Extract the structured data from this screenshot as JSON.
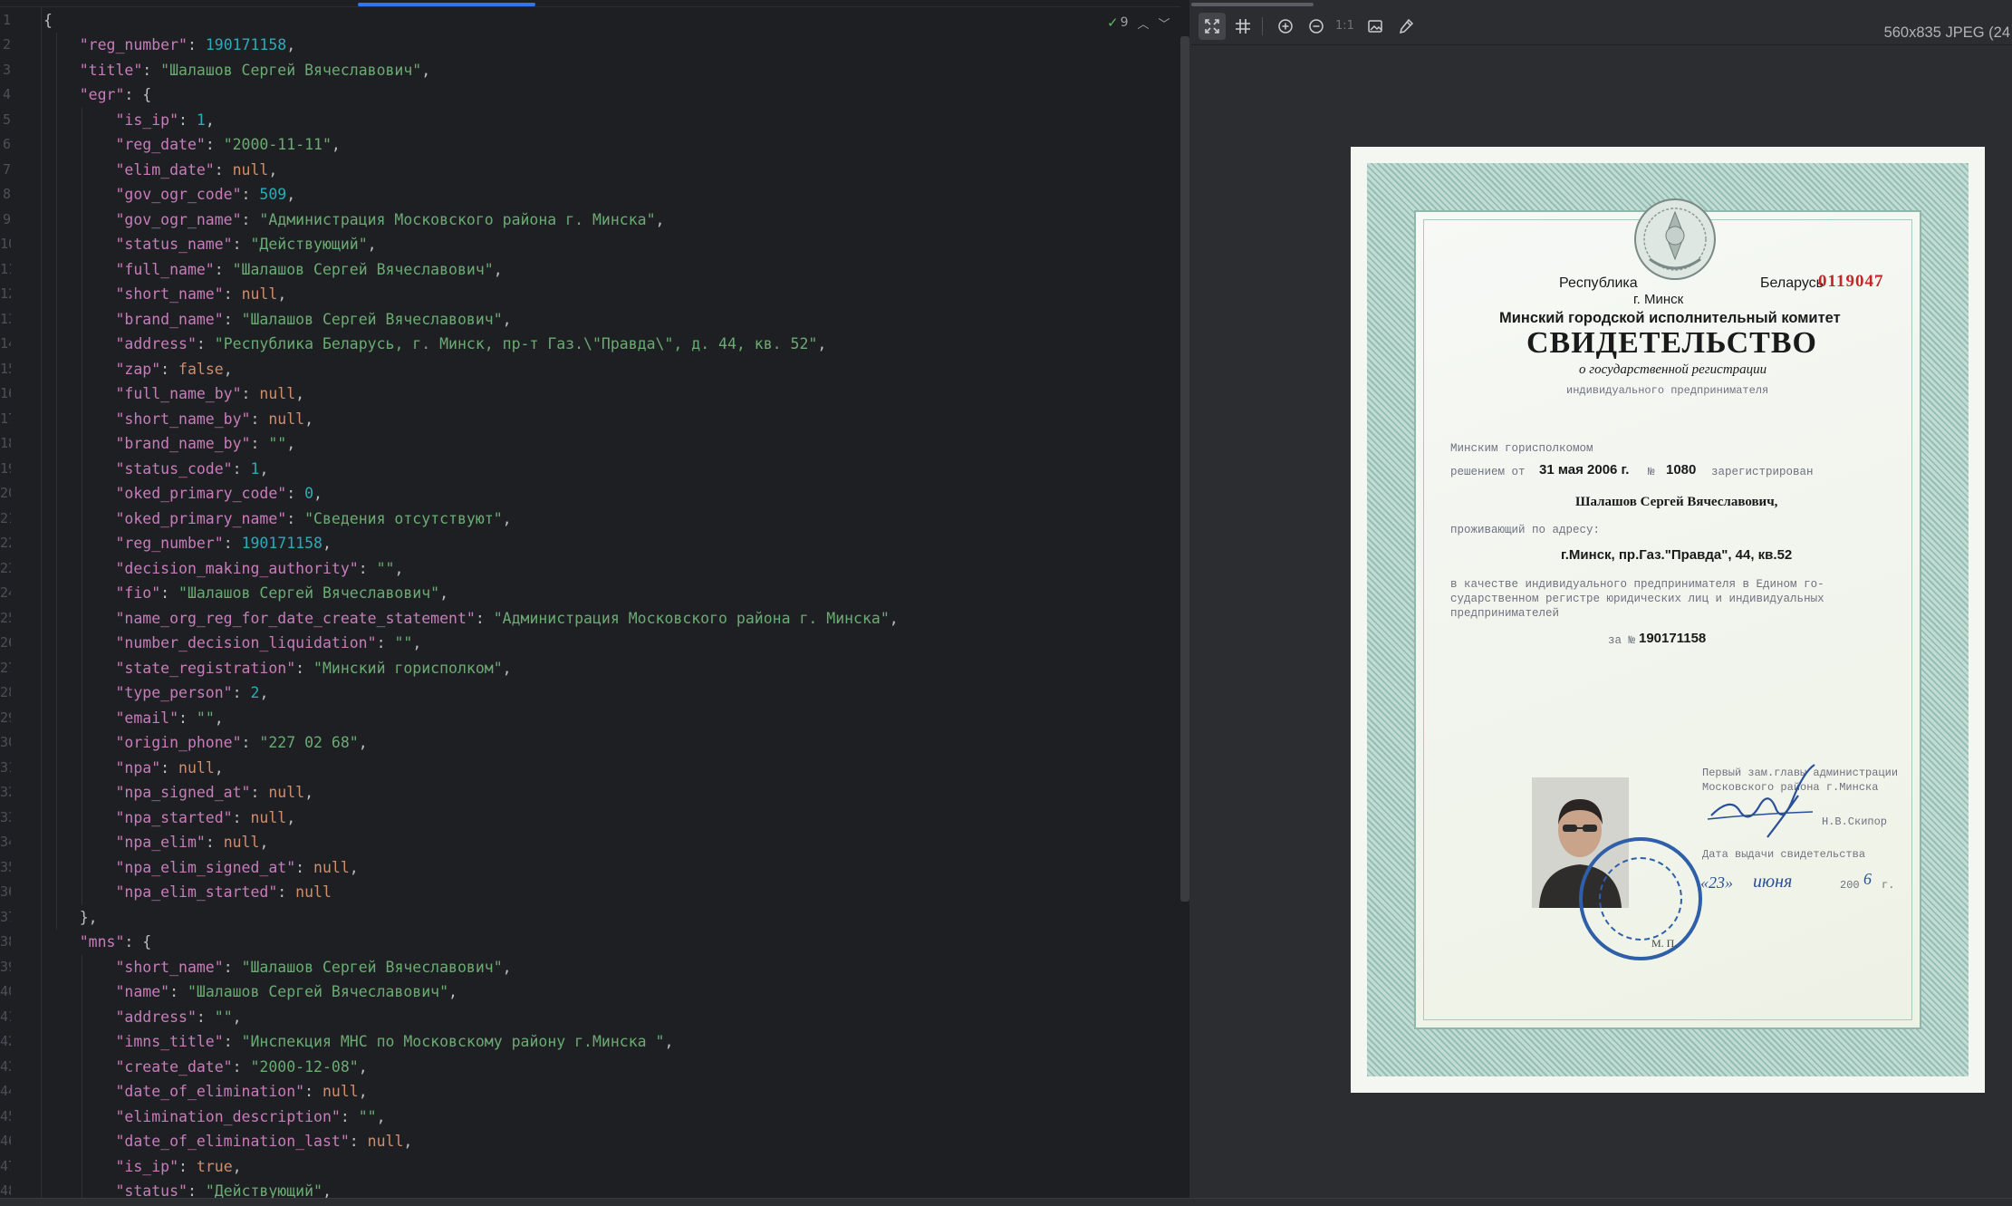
{
  "editor": {
    "lines": [
      [
        [
          "p",
          "{"
        ]
      ],
      [
        [
          "k",
          "    \"reg_number\""
        ],
        [
          "p",
          ": "
        ],
        [
          "n",
          "190171158"
        ],
        [
          "p",
          ","
        ]
      ],
      [
        [
          "k",
          "    \"title\""
        ],
        [
          "p",
          ": "
        ],
        [
          "s",
          "\"Шалашов Сергей Вячеславович\""
        ],
        [
          "p",
          ","
        ]
      ],
      [
        [
          "k",
          "    \"egr\""
        ],
        [
          "p",
          ": {"
        ]
      ],
      [
        [
          "k",
          "        \"is_ip\""
        ],
        [
          "p",
          ": "
        ],
        [
          "n",
          "1"
        ],
        [
          "p",
          ","
        ]
      ],
      [
        [
          "k",
          "        \"reg_date\""
        ],
        [
          "p",
          ": "
        ],
        [
          "s",
          "\"2000-11-11\""
        ],
        [
          "p",
          ","
        ]
      ],
      [
        [
          "k",
          "        \"elim_date\""
        ],
        [
          "p",
          ": "
        ],
        [
          "kw",
          "null"
        ],
        [
          "p",
          ","
        ]
      ],
      [
        [
          "k",
          "        \"gov_ogr_code\""
        ],
        [
          "p",
          ": "
        ],
        [
          "n",
          "509"
        ],
        [
          "p",
          ","
        ]
      ],
      [
        [
          "k",
          "        \"gov_ogr_name\""
        ],
        [
          "p",
          ": "
        ],
        [
          "s",
          "\"Администрация Московского района г. Минска\""
        ],
        [
          "p",
          ","
        ]
      ],
      [
        [
          "k",
          "        \"status_name\""
        ],
        [
          "p",
          ": "
        ],
        [
          "s",
          "\"Действующий\""
        ],
        [
          "p",
          ","
        ]
      ],
      [
        [
          "k",
          "        \"full_name\""
        ],
        [
          "p",
          ": "
        ],
        [
          "s",
          "\"Шалашов Сергей Вячеславович\""
        ],
        [
          "p",
          ","
        ]
      ],
      [
        [
          "k",
          "        \"short_name\""
        ],
        [
          "p",
          ": "
        ],
        [
          "kw",
          "null"
        ],
        [
          "p",
          ","
        ]
      ],
      [
        [
          "k",
          "        \"brand_name\""
        ],
        [
          "p",
          ": "
        ],
        [
          "s",
          "\"Шалашов Сергей Вячеславович\""
        ],
        [
          "p",
          ","
        ]
      ],
      [
        [
          "k",
          "        \"address\""
        ],
        [
          "p",
          ": "
        ],
        [
          "s",
          "\"Республика Беларусь, г. Минск, пр-т Газ.\\\"Правда\\\", д. 44, кв. 52\""
        ],
        [
          "p",
          ","
        ]
      ],
      [
        [
          "k",
          "        \"zap\""
        ],
        [
          "p",
          ": "
        ],
        [
          "kw",
          "false"
        ],
        [
          "p",
          ","
        ]
      ],
      [
        [
          "k",
          "        \"full_name_by\""
        ],
        [
          "p",
          ": "
        ],
        [
          "kw",
          "null"
        ],
        [
          "p",
          ","
        ]
      ],
      [
        [
          "k",
          "        \"short_name_by\""
        ],
        [
          "p",
          ": "
        ],
        [
          "kw",
          "null"
        ],
        [
          "p",
          ","
        ]
      ],
      [
        [
          "k",
          "        \"brand_name_by\""
        ],
        [
          "p",
          ": "
        ],
        [
          "s",
          "\"\""
        ],
        [
          "p",
          ","
        ]
      ],
      [
        [
          "k",
          "        \"status_code\""
        ],
        [
          "p",
          ": "
        ],
        [
          "n",
          "1"
        ],
        [
          "p",
          ","
        ]
      ],
      [
        [
          "k",
          "        \"oked_primary_code\""
        ],
        [
          "p",
          ": "
        ],
        [
          "n",
          "0"
        ],
        [
          "p",
          ","
        ]
      ],
      [
        [
          "k",
          "        \"oked_primary_name\""
        ],
        [
          "p",
          ": "
        ],
        [
          "s",
          "\"Сведения отсутствуют\""
        ],
        [
          "p",
          ","
        ]
      ],
      [
        [
          "k",
          "        \"reg_number\""
        ],
        [
          "p",
          ": "
        ],
        [
          "n",
          "190171158"
        ],
        [
          "p",
          ","
        ]
      ],
      [
        [
          "k",
          "        \"decision_making_authority\""
        ],
        [
          "p",
          ": "
        ],
        [
          "s",
          "\"\""
        ],
        [
          "p",
          ","
        ]
      ],
      [
        [
          "k",
          "        \"fio\""
        ],
        [
          "p",
          ": "
        ],
        [
          "s",
          "\"Шалашов Сергей Вячеславович\""
        ],
        [
          "p",
          ","
        ]
      ],
      [
        [
          "k",
          "        \"name_org_reg_for_date_create_statement\""
        ],
        [
          "p",
          ": "
        ],
        [
          "s",
          "\"Администрация Московского района г. Минска\""
        ],
        [
          "p",
          ","
        ]
      ],
      [
        [
          "k",
          "        \"number_decision_liquidation\""
        ],
        [
          "p",
          ": "
        ],
        [
          "s",
          "\"\""
        ],
        [
          "p",
          ","
        ]
      ],
      [
        [
          "k",
          "        \"state_registration\""
        ],
        [
          "p",
          ": "
        ],
        [
          "s",
          "\"Минский горисполком\""
        ],
        [
          "p",
          ","
        ]
      ],
      [
        [
          "k",
          "        \"type_person\""
        ],
        [
          "p",
          ": "
        ],
        [
          "n",
          "2"
        ],
        [
          "p",
          ","
        ]
      ],
      [
        [
          "k",
          "        \"email\""
        ],
        [
          "p",
          ": "
        ],
        [
          "s",
          "\"\""
        ],
        [
          "p",
          ","
        ]
      ],
      [
        [
          "k",
          "        \"origin_phone\""
        ],
        [
          "p",
          ": "
        ],
        [
          "s",
          "\"227 02 68\""
        ],
        [
          "p",
          ","
        ]
      ],
      [
        [
          "k",
          "        \"npa\""
        ],
        [
          "p",
          ": "
        ],
        [
          "kw",
          "null"
        ],
        [
          "p",
          ","
        ]
      ],
      [
        [
          "k",
          "        \"npa_signed_at\""
        ],
        [
          "p",
          ": "
        ],
        [
          "kw",
          "null"
        ],
        [
          "p",
          ","
        ]
      ],
      [
        [
          "k",
          "        \"npa_started\""
        ],
        [
          "p",
          ": "
        ],
        [
          "kw",
          "null"
        ],
        [
          "p",
          ","
        ]
      ],
      [
        [
          "k",
          "        \"npa_elim\""
        ],
        [
          "p",
          ": "
        ],
        [
          "kw",
          "null"
        ],
        [
          "p",
          ","
        ]
      ],
      [
        [
          "k",
          "        \"npa_elim_signed_at\""
        ],
        [
          "p",
          ": "
        ],
        [
          "kw",
          "null"
        ],
        [
          "p",
          ","
        ]
      ],
      [
        [
          "k",
          "        \"npa_elim_started\""
        ],
        [
          "p",
          ": "
        ],
        [
          "kw",
          "null"
        ]
      ],
      [
        [
          "p",
          "    },"
        ]
      ],
      [
        [
          "k",
          "    \"mns\""
        ],
        [
          "p",
          ": {"
        ]
      ],
      [
        [
          "k",
          "        \"short_name\""
        ],
        [
          "p",
          ": "
        ],
        [
          "s",
          "\"Шалашов Сергей Вячеславович\""
        ],
        [
          "p",
          ","
        ]
      ],
      [
        [
          "k",
          "        \"name\""
        ],
        [
          "p",
          ": "
        ],
        [
          "s",
          "\"Шалашов Сергей Вячеславович\""
        ],
        [
          "p",
          ","
        ]
      ],
      [
        [
          "k",
          "        \"address\""
        ],
        [
          "p",
          ": "
        ],
        [
          "s",
          "\"\""
        ],
        [
          "p",
          ","
        ]
      ],
      [
        [
          "k",
          "        \"imns_title\""
        ],
        [
          "p",
          ": "
        ],
        [
          "s",
          "\"Инспекция МНС по Московскому району г.Минска \""
        ],
        [
          "p",
          ","
        ]
      ],
      [
        [
          "k",
          "        \"create_date\""
        ],
        [
          "p",
          ": "
        ],
        [
          "s",
          "\"2000-12-08\""
        ],
        [
          "p",
          ","
        ]
      ],
      [
        [
          "k",
          "        \"date_of_elimination\""
        ],
        [
          "p",
          ": "
        ],
        [
          "kw",
          "null"
        ],
        [
          "p",
          ","
        ]
      ],
      [
        [
          "k",
          "        \"elimination_description\""
        ],
        [
          "p",
          ": "
        ],
        [
          "s",
          "\"\""
        ],
        [
          "p",
          ","
        ]
      ],
      [
        [
          "k",
          "        \"date_of_elimination_last\""
        ],
        [
          "p",
          ": "
        ],
        [
          "kw",
          "null"
        ],
        [
          "p",
          ","
        ]
      ],
      [
        [
          "k",
          "        \"is_ip\""
        ],
        [
          "p",
          ": "
        ],
        [
          "kw",
          "true"
        ],
        [
          "p",
          ","
        ]
      ],
      [
        [
          "k",
          "        \"status\""
        ],
        [
          "p",
          ": "
        ],
        [
          "s",
          "\"Действующий\""
        ],
        [
          "p",
          ","
        ]
      ]
    ],
    "inspection": {
      "count": "9",
      "icon": "check-icon"
    }
  },
  "viewer": {
    "image_info": "560x835 JPEG (24",
    "toolbar": {
      "fit_icon": "fit-to-window-icon",
      "grid_icon": "grid-icon",
      "zoom_in_icon": "zoom-in-icon",
      "zoom_out_icon": "zoom-out-icon",
      "actual_size_label": "1:1",
      "background_icon": "background-icon",
      "color_picker_icon": "color-picker-icon"
    },
    "certificate": {
      "republic": "Республика",
      "belarus": "Беларусь",
      "serial": "0119047",
      "city": "г. Минск",
      "committee": "Минский городской исполнительный комитет",
      "title": "СВИДЕТЕЛЬСТВО",
      "subtitle": "о государственной регистрации",
      "subtitle2": "индивидуального предпринимателя",
      "issuer": "Минским горисполкомом",
      "decision_prefix": "решением от",
      "decision_date": "31 мая 2006 г.",
      "decision_no_prefix": "№",
      "decision_no": "1080",
      "registered": "зарегистрирован",
      "person": "Шалашов Сергей Вячеславович,",
      "residing": "проживающий по адресу:",
      "address": "г.Минск, пр.Газ.\"Правда\", 44, кв.52",
      "desc_line1": "в качестве индивидуального предпринимателя в Едином го-",
      "desc_line2": "сударственном регистре юридических лиц и индивидуальных",
      "desc_line3": "предпринимателей",
      "number_prefix": "за №",
      "number": "190171158",
      "signer_title1": "Первый зам.главы администрации",
      "signer_title2": "Московского района г.Минска",
      "signer_name": "Н.В.Скипор",
      "issue_label": "Дата выдачи свидетельства",
      "issue_day": "«23»",
      "issue_month": "июня",
      "issue_year_prefix": "200",
      "issue_year_suffix": "6",
      "issue_year_end": "г.",
      "mp": "М. П."
    }
  }
}
